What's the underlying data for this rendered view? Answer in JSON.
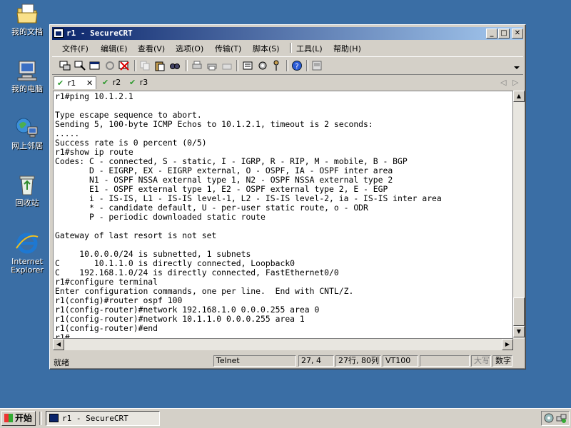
{
  "desktop": {
    "icons": [
      {
        "label": "我的文档",
        "icon": "my-documents-icon"
      },
      {
        "label": "我的电脑",
        "icon": "my-computer-icon"
      },
      {
        "label": "网上邻居",
        "icon": "network-places-icon"
      },
      {
        "label": "回收站",
        "icon": "recycle-bin-icon"
      },
      {
        "label": "Internet Explorer",
        "icon": "internet-explorer-icon"
      }
    ]
  },
  "window": {
    "title": "r1 - SecureCRT",
    "controls": {
      "minimize": "_",
      "maximize": "□",
      "close": "✕"
    },
    "menu": [
      "文件(F)",
      "编辑(E)",
      "查看(V)",
      "选项(O)",
      "传输(T)",
      "脚本(S)",
      "工具(L)",
      "帮助(H)"
    ],
    "tabs": [
      {
        "label": "r1",
        "close": "✕"
      },
      {
        "label": "r2"
      },
      {
        "label": "r3"
      }
    ],
    "tab_nav": {
      "prev": "◁",
      "next": "▷"
    },
    "terminal_text": "r1#ping 10.1.2.1\n\nType escape sequence to abort.\nSending 5, 100-byte ICMP Echos to 10.1.2.1, timeout is 2 seconds:\n.....\nSuccess rate is 0 percent (0/5)\nr1#show ip route\nCodes: C - connected, S - static, I - IGRP, R - RIP, M - mobile, B - BGP\n       D - EIGRP, EX - EIGRP external, O - OSPF, IA - OSPF inter area\n       N1 - OSPF NSSA external type 1, N2 - OSPF NSSA external type 2\n       E1 - OSPF external type 1, E2 - OSPF external type 2, E - EGP\n       i - IS-IS, L1 - IS-IS level-1, L2 - IS-IS level-2, ia - IS-IS inter area\n       * - candidate default, U - per-user static route, o - ODR\n       P - periodic downloaded static route\n\nGateway of last resort is not set\n\n     10.0.0.0/24 is subnetted, 1 subnets\nC       10.1.1.0 is directly connected, Loopback0\nC    192.168.1.0/24 is directly connected, FastEthernet0/0\nr1#configure terminal\nEnter configuration commands, one per line.  End with CNTL/Z.\nr1(config)#router ospf 100\nr1(config-router)#network 192.168.1.0 0.0.0.255 area 0\nr1(config-router)#network 10.1.1.0 0.0.0.255 area 1\nr1(config-router)#end\nr1#",
    "status": {
      "ready": "就绪",
      "protocol": "Telnet",
      "cursor": "27,  4",
      "size": "27行, 80列",
      "emulation": "VT100",
      "caps": "大写",
      "num": "数字"
    }
  },
  "taskbar": {
    "start_label": "开始",
    "task_label": "r1 - SecureCRT"
  }
}
